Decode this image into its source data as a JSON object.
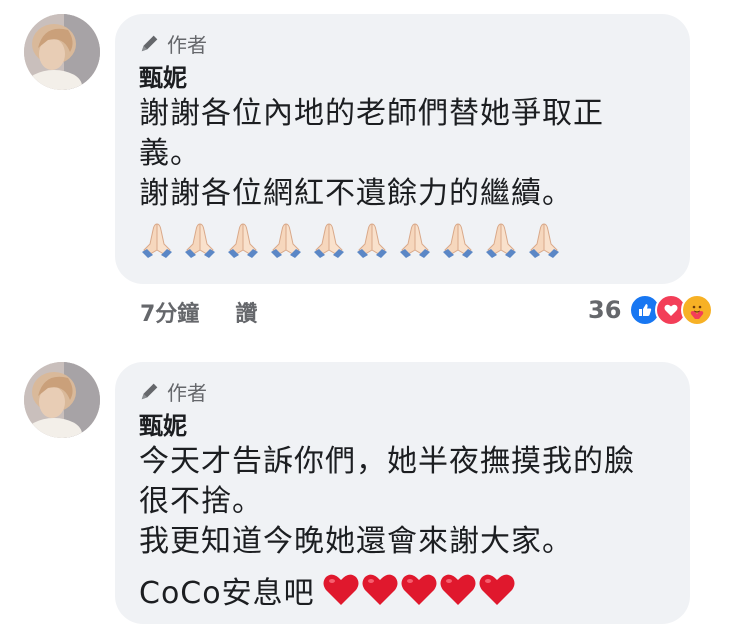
{
  "comments": [
    {
      "author_badge": "作者",
      "name": "甄妮",
      "lines": [
        "謝謝各位內地的老師們替她爭取正",
        "義。",
        "謝謝各位網紅不遺餘力的繼續。"
      ],
      "emoji": "folded-hands-emoji",
      "emoji_count": 10,
      "time": "7分鐘",
      "like_label": "讚",
      "reaction_count": "36",
      "reactions": [
        "like-reaction-icon",
        "love-reaction-icon",
        "care-reaction-icon"
      ]
    },
    {
      "author_badge": "作者",
      "name": "甄妮",
      "lines": [
        "今天才告訴你們，她半夜撫摸我的臉",
        "很不捨。",
        "我更知道今晚她還會來謝大家。"
      ],
      "last_line_text": "CoCo安息吧",
      "hearts_count": 5
    }
  ],
  "colors": {
    "bubble": "#f0f2f5",
    "meta_text": "#65676b",
    "like_blue": "#1877f2",
    "love_red": "#f33e58",
    "heart_red": "#e0182d",
    "care_yellow": "#f7b125"
  }
}
